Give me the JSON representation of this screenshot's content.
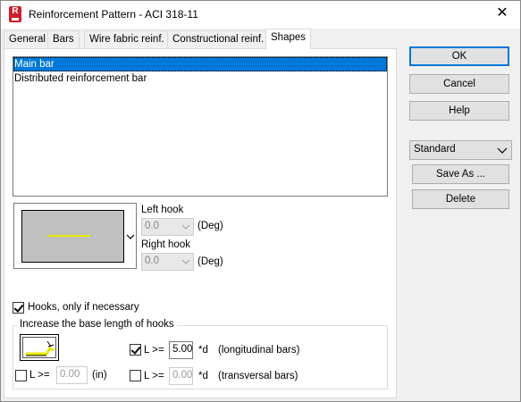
{
  "window": {
    "title": "Reinforcement Pattern - ACI 318-11",
    "app_icon": "revit-r-icon",
    "close_glyph": "✕"
  },
  "tabs": [
    {
      "label": "General"
    },
    {
      "label": "Bars"
    },
    {
      "label": "Wire fabric reinf."
    },
    {
      "label": "Constructional reinf."
    },
    {
      "label": "Shapes",
      "active": true
    }
  ],
  "shapes": {
    "list": [
      "Main bar",
      "Distributed reinforcement bar"
    ],
    "selected_index": 0,
    "preview_line_color": "#e7e700",
    "left_hook_label": "Left hook",
    "left_hook_value": "0.0",
    "left_hook_unit": "(Deg)",
    "right_hook_label": "Right hook",
    "right_hook_value": "0.0",
    "right_hook_unit": "(Deg)",
    "hooks_if_necessary_label": "Hooks, only if necessary",
    "hooks_if_necessary_checked": true,
    "increase_group_title": "Increase the base length of hooks",
    "hook_l_label": "L >=",
    "hook_l_value": "0.00",
    "hook_l_unit": "(in)",
    "hook_l_checked": false,
    "long_l_label": "L >=",
    "long_l_value": "5.00",
    "long_l_unit": "*d",
    "long_l_desc": "(longitudinal bars)",
    "long_l_checked": true,
    "trans_l_label": "L >=",
    "trans_l_value": "0.00",
    "trans_l_unit": "*d",
    "trans_l_desc": "(transversal bars)",
    "trans_l_checked": false
  },
  "buttons": {
    "ok": "OK",
    "cancel": "Cancel",
    "help": "Help",
    "save_as": "Save As ...",
    "delete": "Delete"
  },
  "template_select": {
    "value": "Standard"
  },
  "accent_color": "#0078d7"
}
